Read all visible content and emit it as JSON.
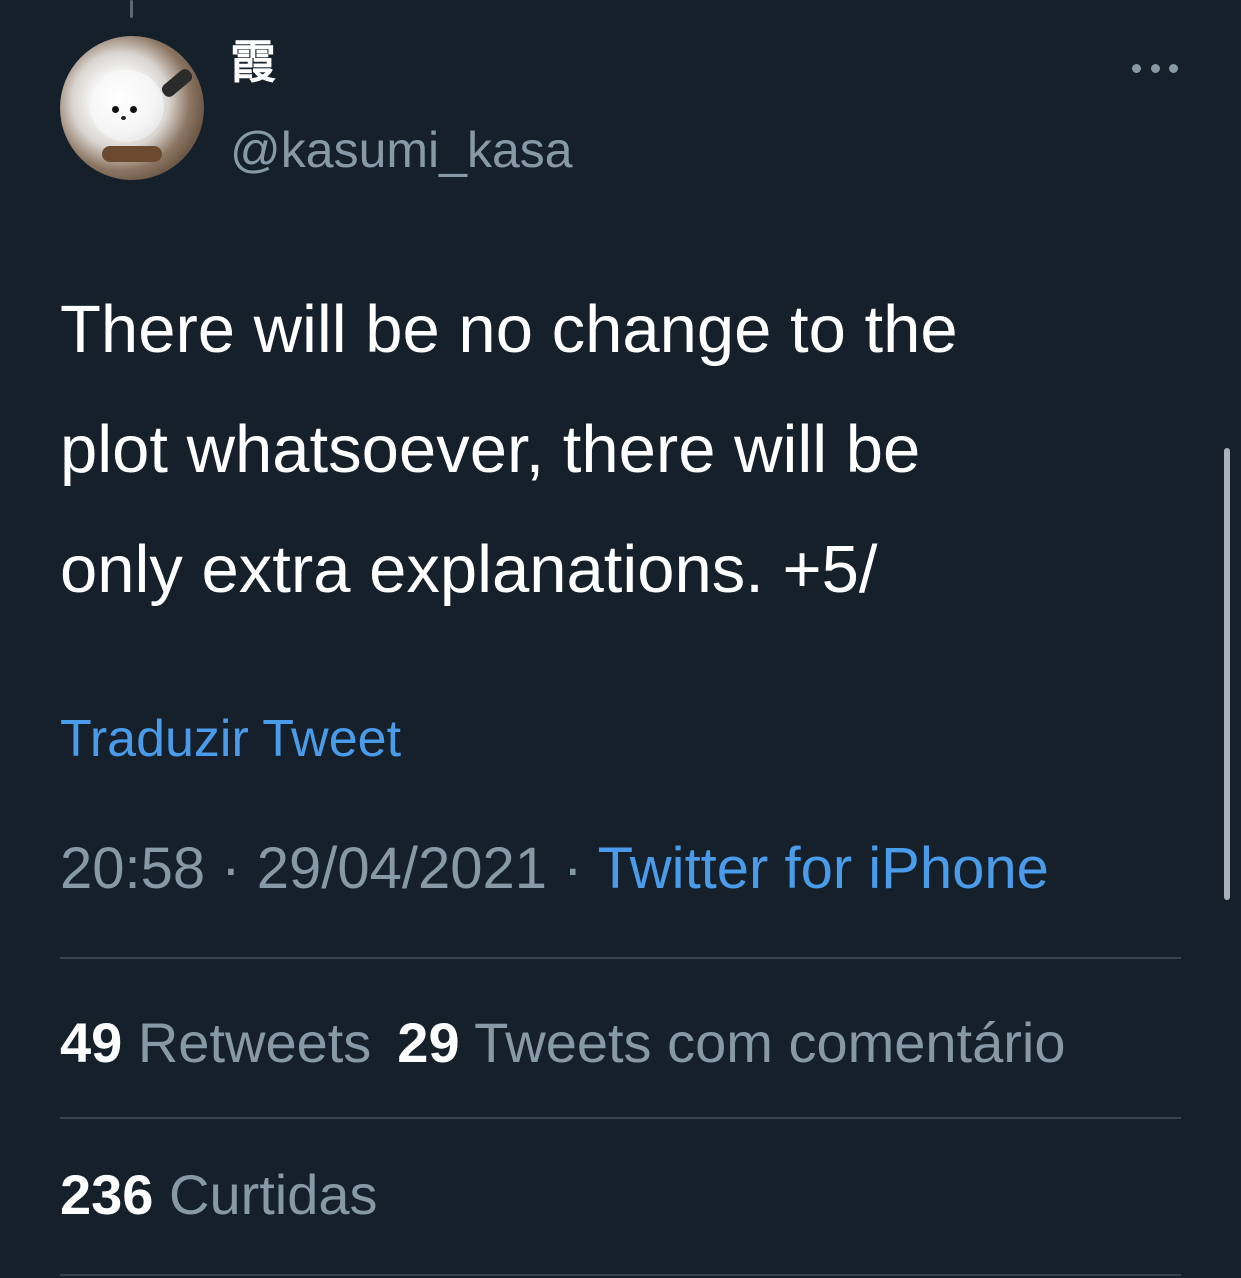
{
  "tweet": {
    "display_name": "霞",
    "handle": "@kasumi_kasa",
    "text_lines": [
      "There will be no change to the",
      "plot whatsoever, there will be",
      "only extra explanations. +5/"
    ],
    "translate_label": "Traduzir Tweet",
    "time": "20:58",
    "separator": "·",
    "date": "29/04/2021",
    "source": "Twitter for iPhone"
  },
  "stats": {
    "retweets_count": "49",
    "retweets_label": "Retweets",
    "quotes_count": "29",
    "quotes_label": "Tweets com comentário",
    "likes_count": "236",
    "likes_label": "Curtidas"
  },
  "icons": {
    "more": "more-horizontal-icon",
    "avatar": "avatar-image"
  },
  "colors": {
    "background": "#15202b",
    "text_primary": "#ffffff",
    "text_secondary": "#8899a6",
    "link": "#4a9be9",
    "divider": "#38444d"
  }
}
